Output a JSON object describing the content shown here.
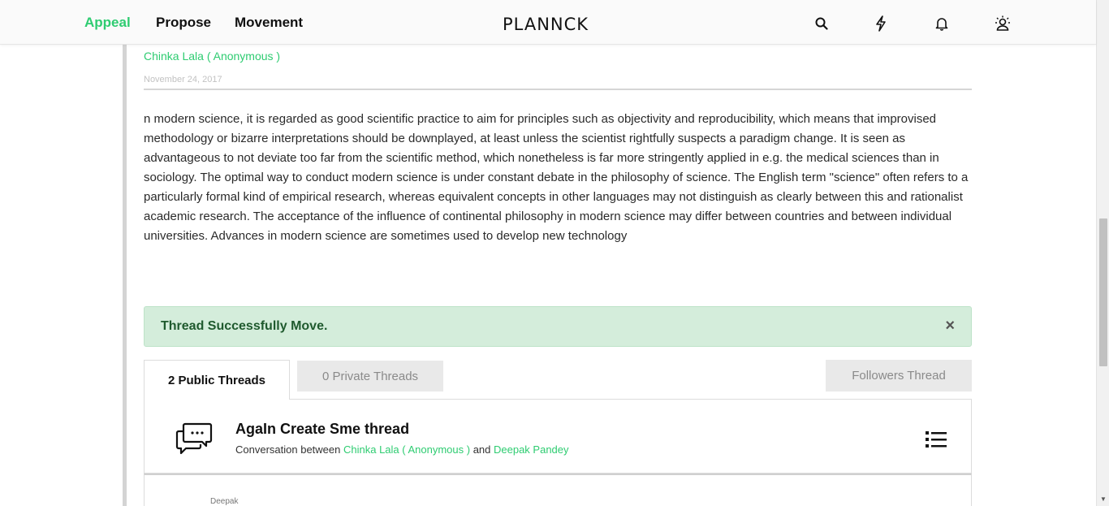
{
  "nav": {
    "links": [
      {
        "label": "Appeal",
        "active": true
      },
      {
        "label": "Propose",
        "active": false
      },
      {
        "label": "Movement",
        "active": false
      }
    ],
    "logo": "PLANNCK",
    "icons": [
      "search-icon",
      "lightning-icon",
      "bell-icon",
      "profile-icon"
    ]
  },
  "post": {
    "author": "Chinka Lala ( Anonymous )",
    "date": "November 24, 2017",
    "body": "n modern science, it is regarded as good scientific practice to aim for principles such as objectivity and reproducibility, which means that improvised methodology or bizarre interpretations should be downplayed, at least unless the scientist rightfully suspects a paradigm change. It is seen as advantageous to not deviate too far from the scientific method, which nonetheless is far more stringently applied in e.g. the medical sciences than in sociology. The optimal way to conduct modern science is under constant debate in the philosophy of science. The English term \"science\" often refers to a particularly formal kind of empirical research, whereas equivalent concepts in other languages may not distinguish as clearly between this and rationalist academic research. The acceptance of the influence of continental philosophy in modern science may differ between countries and between individual universities. Advances in modern science are sometimes used to develop new technology"
  },
  "alert": {
    "message": "Thread Successfully Move.",
    "close_symbol": "×"
  },
  "tabs": {
    "public": "2 Public Threads",
    "private": "0 Private Threads",
    "followers": "Followers Thread"
  },
  "thread": {
    "title": "AgaIn Create Sme thread",
    "sub_prefix": "Conversation between ",
    "participant_a": "Chinka Lala ( Anonymous )",
    "sub_and": " and ",
    "participant_b": "Deepak Pandey"
  },
  "reply": {
    "name": "Deepak"
  },
  "colors": {
    "accent": "#2ecc71",
    "alert_bg": "#d4eddb",
    "alert_text": "#1f5a2e"
  }
}
